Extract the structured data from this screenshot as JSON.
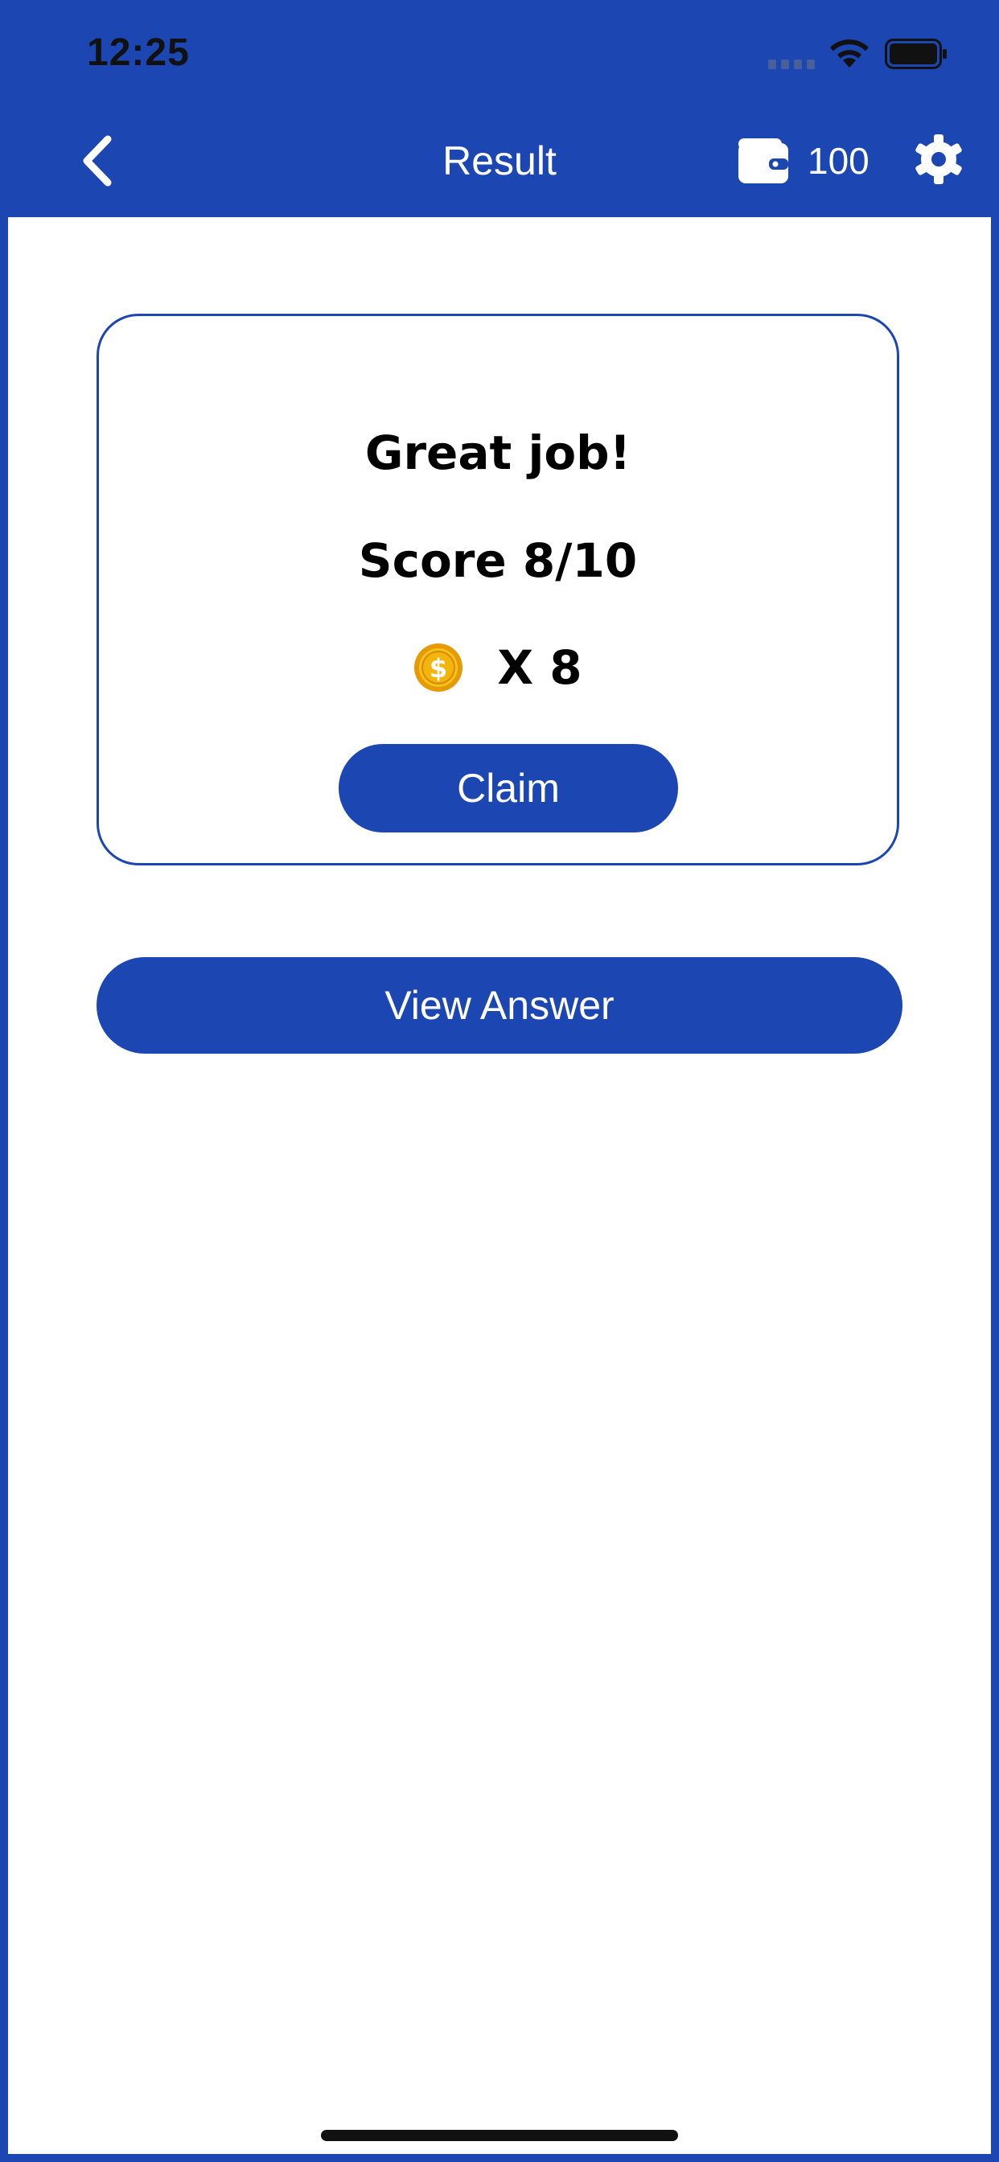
{
  "status_bar": {
    "time": "12:25",
    "icons": [
      "signal-icon",
      "wifi-icon",
      "battery-icon"
    ]
  },
  "nav": {
    "back_icon": "chevron-left-icon",
    "title": "Result",
    "wallet_icon": "wallet-icon",
    "wallet_balance": "100",
    "settings_icon": "gear-icon"
  },
  "result": {
    "headline": "Great job!",
    "score": "Score 8/10",
    "reward_icon": "coin-icon",
    "reward": "X 8",
    "claim_label": "Claim"
  },
  "actions": {
    "view_answer_label": "View Answer"
  },
  "colors": {
    "brand": "#1c46b1",
    "background": "#ffffff",
    "text": "#000000",
    "coin": "#f2b50c"
  }
}
